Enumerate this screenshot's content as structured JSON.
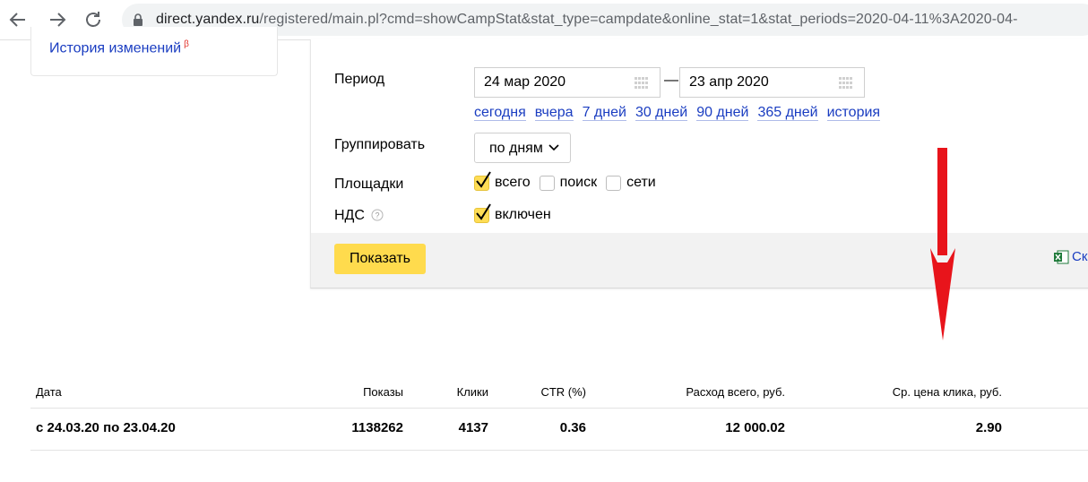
{
  "browser": {
    "url_host": "direct.yandex.ru",
    "url_path": "/registered/main.pl?cmd=showCampStat&stat_type=campdate&online_stat=1&stat_periods=2020-04-11%3A2020-04-"
  },
  "sidebar": {
    "history_link": "История изменений",
    "history_marker": "β"
  },
  "filters": {
    "period_label": "Период",
    "date_from": "24 мар 2020",
    "date_separator": "—",
    "date_to": "23 апр 2020",
    "quick_periods": [
      "сегодня",
      "вчера",
      "7 дней",
      "30 дней",
      "90 дней",
      "365 дней",
      "история"
    ],
    "group_label": "Группировать",
    "group_value": "по дням",
    "platforms_label": "Площадки",
    "platforms": [
      {
        "label": "всего",
        "checked": true
      },
      {
        "label": "поиск",
        "checked": false
      },
      {
        "label": "сети",
        "checked": false
      }
    ],
    "vat_label": "НДС",
    "vat_option": {
      "label": "включен",
      "checked": true
    },
    "show_button": "Показать",
    "export_link": "Ск"
  },
  "table": {
    "headers": [
      "Дата",
      "Показы",
      "Клики",
      "CTR (%)",
      "Расход всего, руб.",
      "Ср. цена клика, руб."
    ],
    "row": [
      "с 24.03.20 по 23.04.20",
      "1138262",
      "4137",
      "0.36",
      "12 000.02",
      "2.90"
    ]
  },
  "colors": {
    "accent_yellow": "#ffdb4d",
    "link_blue": "#1a3dc1",
    "annotation_red": "#e8141b"
  }
}
